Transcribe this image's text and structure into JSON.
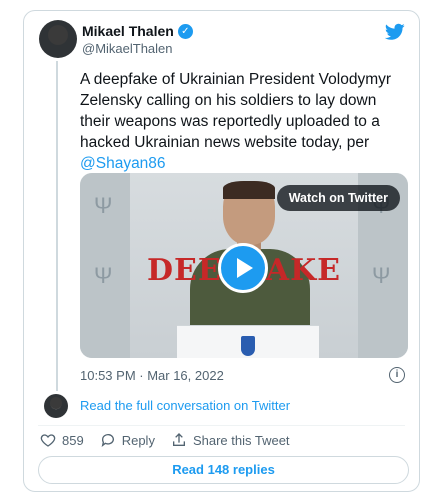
{
  "author": {
    "name": "Mikael Thalen",
    "handle": "@MikaelThalen",
    "verified_badge": "verified-badge-icon"
  },
  "tweet": {
    "text": "A deepfake of Ukrainian President Volodymyr Zelensky calling on his soldiers to lay down their weapons was reportedly uploaded to a hacked Ukrainian news website today, per ",
    "mention": "@Shayan86"
  },
  "media": {
    "overlay_text": "DEEPFAKE",
    "watch_label": "Watch on Twitter",
    "play_icon": "play-icon"
  },
  "meta": {
    "timestamp": "10:53 PM · Mar 16, 2022"
  },
  "conversation": {
    "link_text": "Read the full conversation on Twitter"
  },
  "actions": {
    "like_count": "859",
    "reply_label": "Reply",
    "share_label": "Share this Tweet"
  },
  "replies_button": {
    "label": "Read 148 replies"
  },
  "colors": {
    "accent": "#1d9bf0",
    "text": "#0f1419",
    "muted": "#536471",
    "border": "#cfd9de"
  }
}
